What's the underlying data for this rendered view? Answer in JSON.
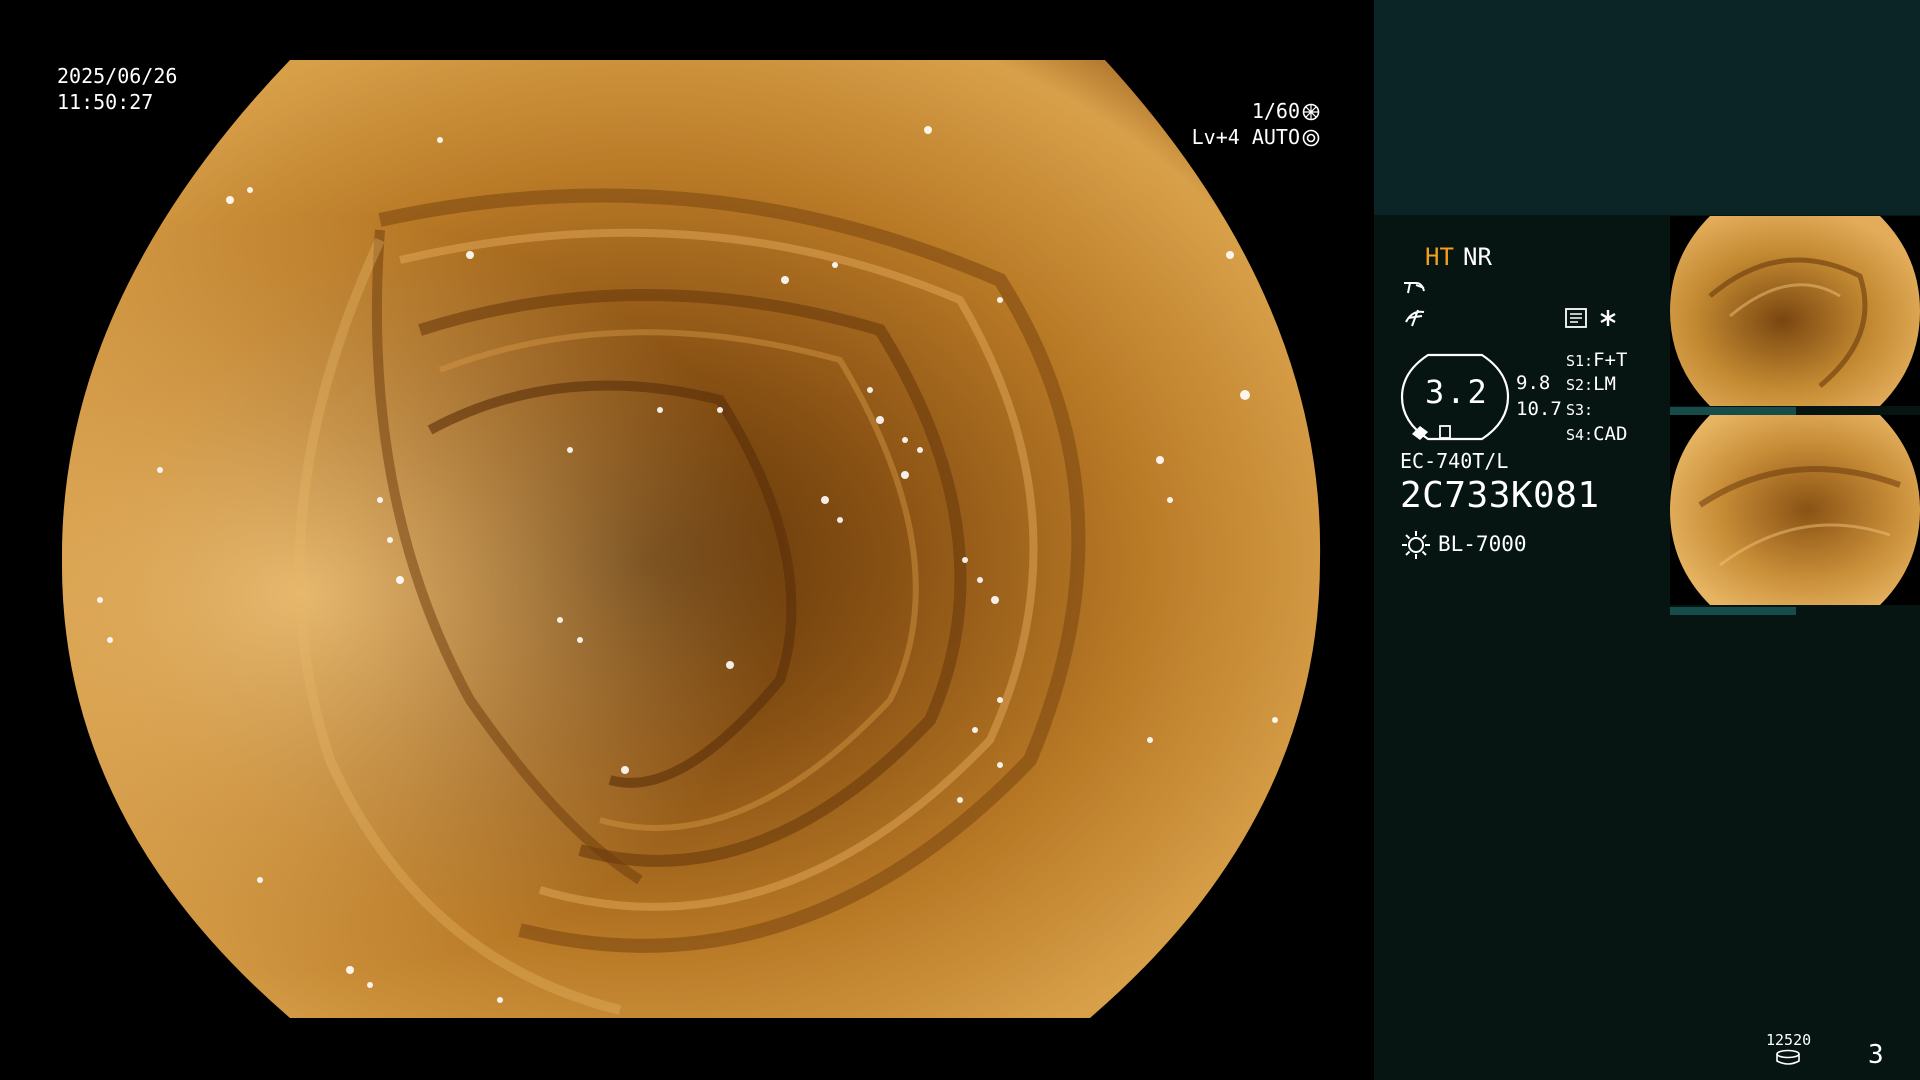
{
  "overlay": {
    "date": "2025/06/26",
    "time": "11:50:27",
    "shutter": "1/60",
    "exposure": "Lv+4 AUTO"
  },
  "panel": {
    "mode_ht": "HT",
    "mode_nr": "NR",
    "zoom": "3.2",
    "zoom_r1": "9.8",
    "zoom_r2": "10.7",
    "switches": [
      {
        "key": "S1:",
        "value": "F+T"
      },
      {
        "key": "S2:",
        "value": "LM"
      },
      {
        "key": "S3:",
        "value": ""
      },
      {
        "key": "S4:",
        "value": "CAD"
      }
    ],
    "scope_model": "EC-740T/L",
    "scope_serial": "2C733K081",
    "light_source": "BL-7000",
    "counter": "12520",
    "page": "3"
  },
  "colors": {
    "accent_ht": "#f0a020",
    "panel_bg": "#061412",
    "panel_top": "#0b2426",
    "thumb_bar": "#164c4a"
  },
  "icons": {
    "shutter": "shutter-icon",
    "auto_iris": "iris-icon",
    "structure": "structure-enhance-icon",
    "color": "color-enhance-icon",
    "record": "record-icon",
    "asterisk": "asterisk-icon",
    "light": "light-source-icon",
    "counter": "film-counter-icon"
  }
}
